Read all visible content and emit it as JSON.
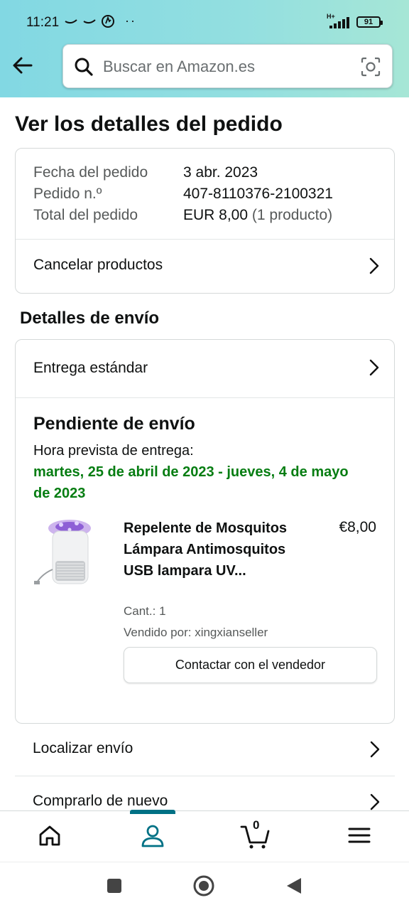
{
  "status_bar": {
    "time": "11:21",
    "network": "H+",
    "battery": "91"
  },
  "search": {
    "placeholder": "Buscar en Amazon.es"
  },
  "page": {
    "title": "Ver los detalles del pedido"
  },
  "order": {
    "date_label": "Fecha del pedido",
    "date_value": "3 abr. 2023",
    "number_label": "Pedido n.º",
    "number_value": "407-8110376-2100321",
    "total_label": "Total del pedido",
    "total_value": "EUR 8,00",
    "total_items": "(1 producto)",
    "cancel_label": "Cancelar productos"
  },
  "shipping": {
    "section_title": "Detalles de envío",
    "method": "Entrega estándar",
    "status": "Pendiente de envío",
    "delivery_label": "Hora prevista de entrega:",
    "delivery_range": "martes, 25 de abril de 2023 - jueves, 4 de mayo de 2023"
  },
  "product": {
    "name": "Repelente de Mosquitos Lámpara Antimosquitos USB lampara UV...",
    "price": "€8,00",
    "quantity": "Cant.: 1",
    "seller": "Vendido por: xingxianseller",
    "contact_button": "Contactar con el vendedor"
  },
  "actions": {
    "track": "Localizar envío",
    "buy_again": "Comprarlo de nuevo"
  },
  "bottom_nav": {
    "cart_count": "0",
    "accent_color": "#007185"
  },
  "colors": {
    "header_gradient_start": "#82d8e3",
    "delivery_green": "#067d12"
  }
}
